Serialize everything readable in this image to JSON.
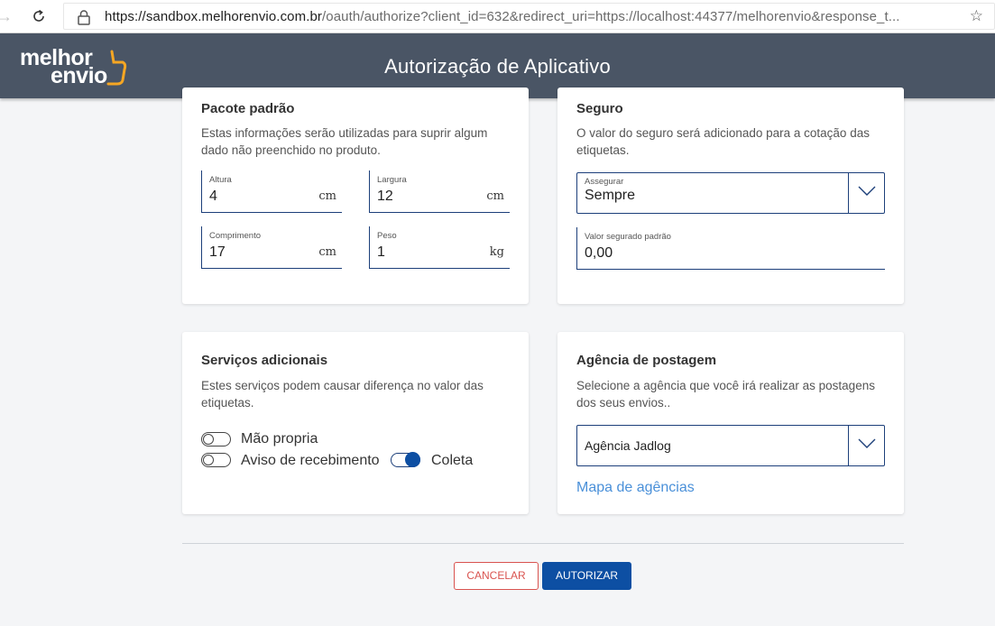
{
  "browser": {
    "url_host": "https://sandbox.melhorenvio.com.br",
    "url_path": "/oauth/authorize?client_id=632&redirect_uri=https://localhost:44377/melhorenvio&response_t..."
  },
  "header": {
    "logo_line1": "melhor",
    "logo_line2": "envio",
    "title": "Autorização de Aplicativo"
  },
  "pacote": {
    "title": "Pacote padrão",
    "description": "Estas informações serão utilizadas para suprir algum dado não preenchido no produto.",
    "fields": {
      "altura": {
        "label": "Altura",
        "value": "4",
        "unit": "cm"
      },
      "largura": {
        "label": "Largura",
        "value": "12",
        "unit": "cm"
      },
      "comprimento": {
        "label": "Comprimento",
        "value": "17",
        "unit": "cm"
      },
      "peso": {
        "label": "Peso",
        "value": "1",
        "unit": "kg"
      }
    }
  },
  "seguro": {
    "title": "Seguro",
    "description": "O valor do seguro será adicionado para a cotação das etiquetas.",
    "assegurar_label": "Assegurar",
    "assegurar_value": "Sempre",
    "valor_label": "Valor segurado padrão",
    "valor_value": "0,00"
  },
  "servicos": {
    "title": "Serviços adicionais",
    "description": "Estes serviços podem causar diferença no valor das etiquetas.",
    "options": {
      "mao_propria": {
        "label": "Mão propria",
        "enabled": false
      },
      "aviso": {
        "label": "Aviso de recebimento",
        "enabled": false
      },
      "coleta": {
        "label": "Coleta",
        "enabled": true
      }
    }
  },
  "agencia": {
    "title": "Agência de postagem",
    "description": "Selecione a agência que você irá realizar as postagens dos seus envios..",
    "selected": "Agência Jadlog",
    "map_link": "Mapa de agências"
  },
  "actions": {
    "cancel_label": "CANCELAR",
    "authorize_label": "AUTORIZAR"
  },
  "colors": {
    "header_bg": "#4a5565",
    "primary": "#0d4fa3",
    "danger": "#d9534f",
    "link": "#4a90d9"
  }
}
